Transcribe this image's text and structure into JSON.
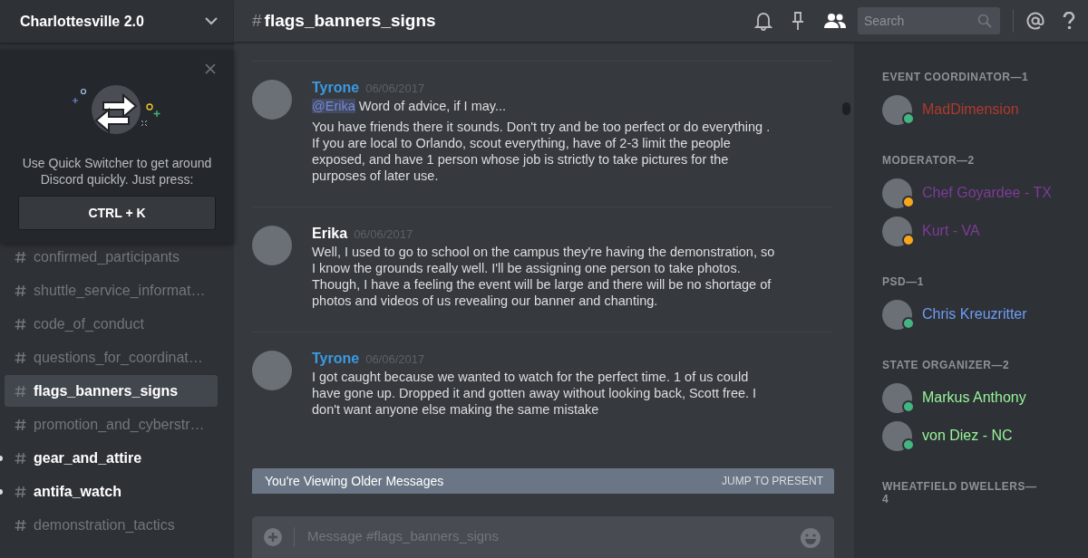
{
  "server": {
    "name": "Charlottesville 2.0"
  },
  "quick_switcher": {
    "text": "Use Quick Switcher to get around Discord quickly. Just press:",
    "shortcut": "CTRL + K"
  },
  "channels": [
    {
      "name": "confirmed_participants",
      "selected": false,
      "unread": false
    },
    {
      "name": "shuttle_service_informat…",
      "selected": false,
      "unread": false
    },
    {
      "name": "code_of_conduct",
      "selected": false,
      "unread": false
    },
    {
      "name": "questions_for_coordinat…",
      "selected": false,
      "unread": false
    },
    {
      "name": "flags_banners_signs",
      "selected": true,
      "unread": false
    },
    {
      "name": "promotion_and_cyberstr…",
      "selected": false,
      "unread": false
    },
    {
      "name": "gear_and_attire",
      "selected": false,
      "unread": true
    },
    {
      "name": "antifa_watch",
      "selected": false,
      "unread": true
    },
    {
      "name": "demonstration_tactics",
      "selected": false,
      "unread": false
    }
  ],
  "header": {
    "hash": "#",
    "channel": "flags_banners_signs",
    "search_placeholder": "Search"
  },
  "messages": [
    {
      "author": "Tyrone",
      "color": "#3b9ae1",
      "time": "06/06/2017",
      "mention": "@Erika",
      "lines": [
        "Word of advice, if I may...",
        "You have friends there it sounds. Don't try and be too perfect or do everything . If you are local to Orlando, scout everything, have of 2-3 limit the people exposed, and have 1 person whose job is strictly to take pictures for the purposes of later use."
      ]
    },
    {
      "author": "Erika",
      "color": "#ffffff",
      "time": "06/06/2017",
      "lines": [
        "Well, I used to go to school on the campus they're having the demonstration, so I know the grounds really well. I'll be assigning one person to take photos. Though, I have a feeling the event will be large and there will be no shortage of photos and videos of us revealing our banner and chanting."
      ]
    },
    {
      "author": "Tyrone",
      "color": "#3b9ae1",
      "time": "06/06/2017",
      "lines": [
        "I got caught because we wanted to watch for the perfect time. 1 of us could have gone up. Dropped it and gotten away without looking back, Scott free. I don't want anyone else making the same mistake"
      ]
    }
  ],
  "older_bar": {
    "text": "You're Viewing Older Messages",
    "action": "JUMP TO PRESENT"
  },
  "composer": {
    "placeholder": "Message #flags_banners_signs"
  },
  "member_groups": [
    {
      "title": "EVENT COORDINATOR—1",
      "members": [
        {
          "name": "MadDimension",
          "color": "#b03a2e",
          "idle": false
        }
      ]
    },
    {
      "title": "MODERATOR—2",
      "members": [
        {
          "name": "Chef Goyardee - TX",
          "color": "#7d3c98",
          "idle": true
        },
        {
          "name": "Kurt - VA",
          "color": "#7d3c98",
          "idle": true
        }
      ]
    },
    {
      "title": "PSD—1",
      "members": [
        {
          "name": "Chris Kreuzritter",
          "color": "#6f9df5",
          "idle": false
        }
      ]
    },
    {
      "title": "STATE ORGANIZER—2",
      "members": [
        {
          "name": "Markus Anthony",
          "color": "#98f59a",
          "idle": false
        },
        {
          "name": "von Diez - NC",
          "color": "#98f59a",
          "idle": false
        }
      ]
    },
    {
      "title": "WHEATFIELD DWELLERS—4"
    }
  ]
}
